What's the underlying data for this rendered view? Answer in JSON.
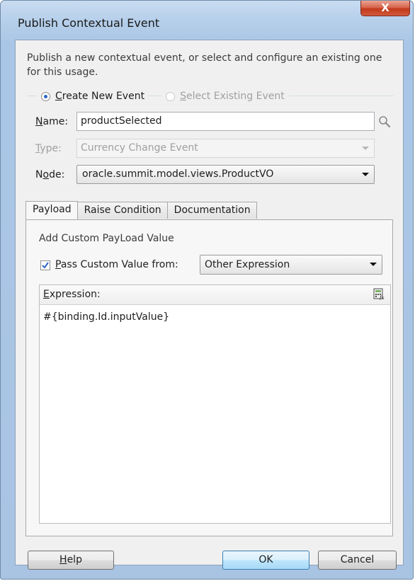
{
  "window": {
    "title": "Publish Contextual Event",
    "close_label": "X"
  },
  "intro_text": "Publish a new contextual event, or select and configure an existing one for this usage.",
  "event_mode": {
    "create_new": {
      "prefix": "",
      "accel": "C",
      "rest": "reate New Event",
      "selected": true
    },
    "select_existing": {
      "prefix": "",
      "accel": "S",
      "rest": "elect Existing Event",
      "selected": false,
      "enabled": false
    }
  },
  "name_field": {
    "label_accel": "N",
    "label_rest": "ame:",
    "value": "productSelected"
  },
  "type_field": {
    "label_accel": "T",
    "label_rest": "ype:",
    "value": "Currency Change Event",
    "enabled": false
  },
  "node_field": {
    "label_pre": "N",
    "label_accel": "o",
    "label_rest": "de:",
    "value": "oracle.summit.model.views.ProductVO"
  },
  "tabs": [
    {
      "label": "Payload",
      "active": true
    },
    {
      "label": "Raise Condition",
      "active": false
    },
    {
      "label": "Documentation",
      "active": false
    }
  ],
  "payload": {
    "heading": "Add Custom PayLoad Value",
    "pass_checkbox": {
      "checked": true,
      "label_accel": "P",
      "label_rest": "ass Custom Value from:"
    },
    "source_select": {
      "value": "Other Expression"
    },
    "expression": {
      "label_accel": "E",
      "label_rest": "xpression:",
      "value": "#{binding.Id.inputValue}"
    }
  },
  "buttons": {
    "help": {
      "accel": "H",
      "rest": "elp"
    },
    "ok": "OK",
    "cancel": "Cancel"
  },
  "icons": {
    "search": "search-icon",
    "expression_builder": "calculator-icon",
    "close": "close-icon",
    "checkmark": "checkmark-icon"
  },
  "colors": {
    "title_bar": "#b6cfea",
    "close_button": "#c2391b",
    "dialog_background": "#f0f0f0",
    "default_button": "#bee6fd",
    "checkmark": "#2d64c8"
  }
}
